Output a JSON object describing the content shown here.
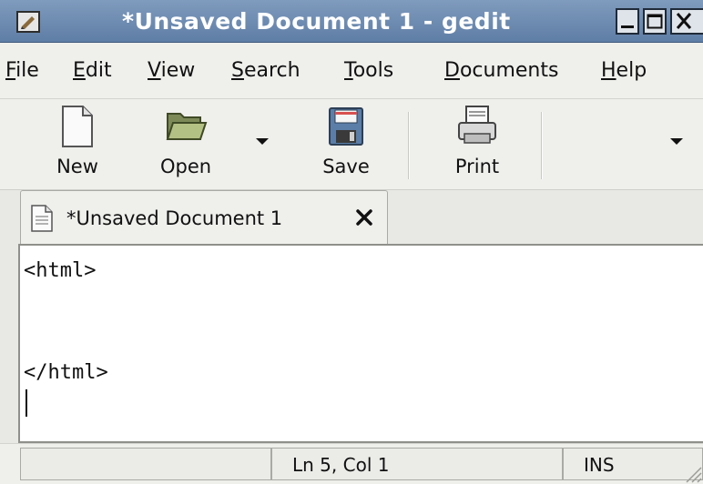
{
  "window": {
    "title": "*Unsaved Document 1 - gedit"
  },
  "menu": {
    "items": [
      {
        "pre": "",
        "u": "F",
        "post": "ile"
      },
      {
        "pre": "",
        "u": "E",
        "post": "dit"
      },
      {
        "pre": "",
        "u": "V",
        "post": "iew"
      },
      {
        "pre": "",
        "u": "S",
        "post": "earch"
      },
      {
        "pre": "",
        "u": "T",
        "post": "ools"
      },
      {
        "pre": "",
        "u": "D",
        "post": "ocuments"
      },
      {
        "pre": "",
        "u": "H",
        "post": "elp"
      }
    ]
  },
  "toolbar": {
    "new_label": "New",
    "open_label": "Open",
    "save_label": "Save",
    "print_label": "Print",
    "icons": [
      "new-document-icon",
      "open-folder-icon",
      "save-floppy-icon",
      "printer-icon",
      "chevron-down-icon"
    ]
  },
  "tabs": [
    {
      "label": "*Unsaved Document 1",
      "icon": "document-icon",
      "close_icon": "close-icon"
    }
  ],
  "editor": {
    "lines": [
      "<html>",
      "",
      "",
      "</html>",
      ""
    ]
  },
  "statusbar": {
    "position": "Ln 5, Col 1",
    "mode": "INS"
  },
  "colors": {
    "titlebar": "#6b89b0",
    "chrome": "#efefec",
    "editor_bg": "#ffffff"
  }
}
